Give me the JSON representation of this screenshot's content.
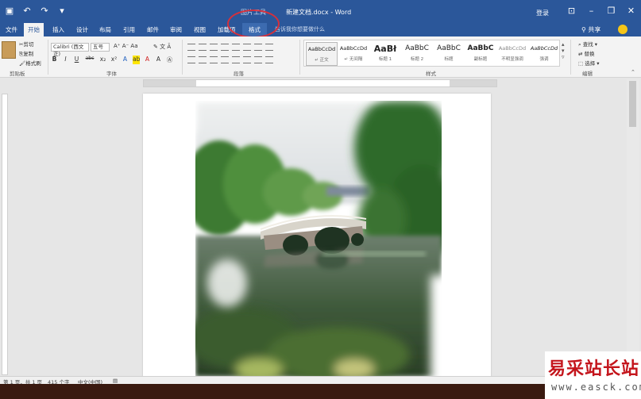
{
  "titlebar": {
    "qat_icons": [
      "save-icon",
      "undo-icon",
      "redo-icon",
      "customize-icon"
    ],
    "context_title": "图片工具",
    "doc_title": "新建文档.docx - Word",
    "login": "登录",
    "window_buttons": [
      "ribbon-display-icon",
      "minimize-icon",
      "restore-icon",
      "close-icon"
    ]
  },
  "tabs": {
    "file": "文件",
    "home": "开始",
    "insert": "插入",
    "design": "设计",
    "layout": "布局",
    "references": "引用",
    "mailings": "邮件",
    "review": "审阅",
    "view": "视图",
    "addins": "加载项",
    "picture_format": "格式",
    "tell_me": "告诉我你想要做什么",
    "share": "共享"
  },
  "ribbon": {
    "clipboard": {
      "label": "剪贴板",
      "paste_icon": "paste-icon",
      "cut": "剪切",
      "copy": "复制",
      "format_painter": "格式刷"
    },
    "font": {
      "label": "字体",
      "font_name": "Calibri (西文正)",
      "font_size": "五号",
      "buttons": [
        "B",
        "I",
        "U",
        "abc",
        "x₂",
        "x²"
      ]
    },
    "paragraph": {
      "label": "段落"
    },
    "styles": {
      "label": "样式",
      "items": [
        {
          "sample": "AaBbCcDd",
          "name": "↵ 正文"
        },
        {
          "sample": "AaBbCcDd",
          "name": "↵ 无间隔"
        },
        {
          "sample": "AaBł",
          "name": "标题 1"
        },
        {
          "sample": "AaBbC",
          "name": "标题 2"
        },
        {
          "sample": "AaBbC",
          "name": "标题"
        },
        {
          "sample": "AaBbC",
          "name": "副标题"
        },
        {
          "sample": "AaBbCcDd",
          "name": "不明显强调"
        },
        {
          "sample": "AaBbCcDd",
          "name": "强调"
        }
      ]
    },
    "editing": {
      "label": "编辑",
      "find": "查找",
      "replace": "替换",
      "select": "选择"
    }
  },
  "statusbar": {
    "page": "第 1 页，共 1 页",
    "words": "415 个字",
    "language": "中文(中国)"
  },
  "watermark": {
    "brand": "易采站长站",
    "url": "www.easck.com"
  },
  "colors": {
    "title_bar": "#2b579a",
    "accent_circle": "#d6303b",
    "watermark_red": "#c4151c"
  }
}
